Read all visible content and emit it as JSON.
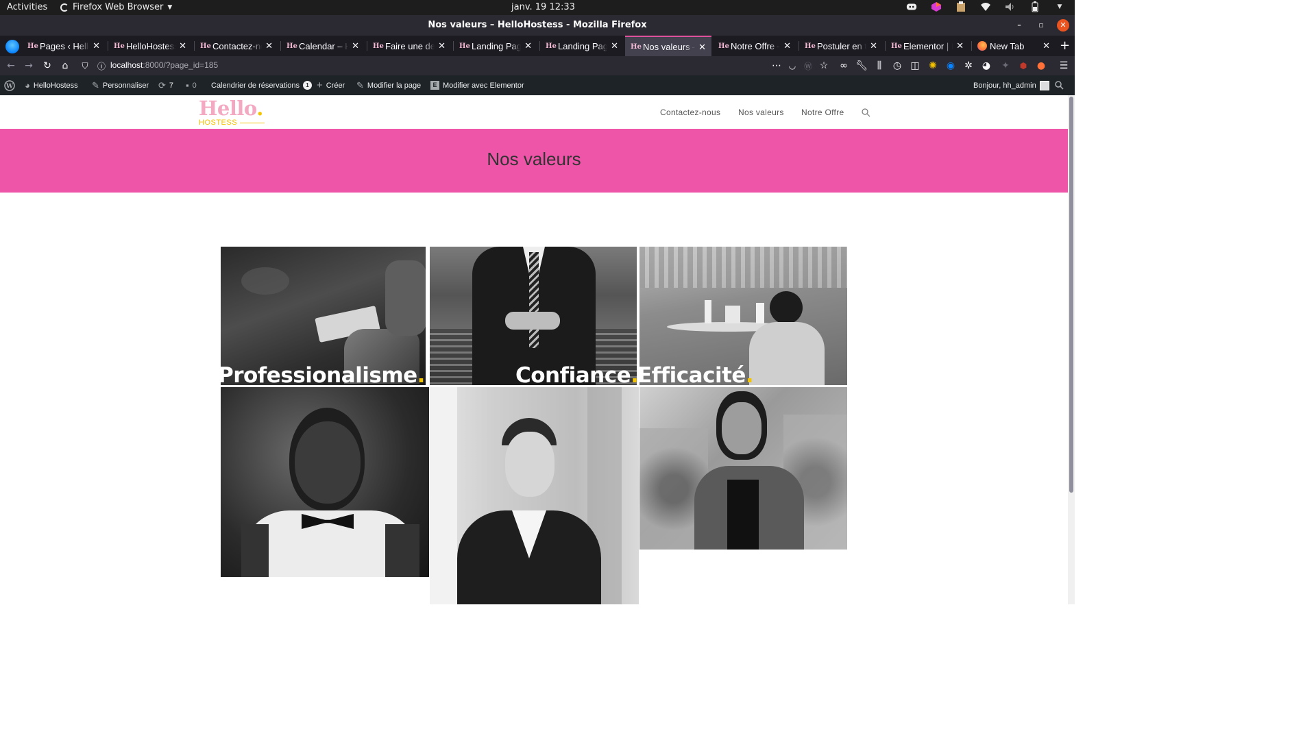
{
  "system": {
    "activities": "Activities",
    "app_menu": "Firefox Web Browser",
    "clock": "janv. 19  12:33"
  },
  "window": {
    "title": "Nos valeurs – HelloHostess - Mozilla Firefox"
  },
  "tabs": [
    {
      "favicon": "He",
      "label": "Pages ‹ HelloHostess"
    },
    {
      "favicon": "He",
      "label": "HelloHostess"
    },
    {
      "favicon": "He",
      "label": "Contactez-nous"
    },
    {
      "favicon": "He",
      "label": "Calendar – HelloHostess"
    },
    {
      "favicon": "He",
      "label": "Faire une demande"
    },
    {
      "favicon": "He",
      "label": "Landing Page"
    },
    {
      "favicon": "He",
      "label": "Landing Page"
    },
    {
      "favicon": "He",
      "label": "Nos valeurs –",
      "active": true
    },
    {
      "favicon": "He",
      "label": "Notre Offre –"
    },
    {
      "favicon": "He",
      "label": "Postuler en tant que"
    },
    {
      "favicon": "He",
      "label": "Elementor | Landing"
    },
    {
      "favicon": "firefox",
      "label": "New Tab"
    }
  ],
  "navbar": {
    "url_host": "localhost",
    "url_path": ":8000/?page_id=185"
  },
  "adminbar": {
    "site_name": "HelloHostess",
    "customize": "Personnaliser",
    "updates_count": "7",
    "comments_count": "0",
    "calendar": "Calendrier de réservations",
    "calendar_badge": "1",
    "new": "Créer",
    "edit_page": "Modifier la page",
    "edit_elementor": "Modifier avec Elementor",
    "greeting": "Bonjour, hh_admin"
  },
  "site": {
    "logo_text": "Hello",
    "logo_dot": ".",
    "logo_sub": "HOSTESS",
    "menu": [
      "Contactez-nous",
      "Nos valeurs",
      "Notre Offre"
    ],
    "page_title": "Nos valeurs"
  },
  "values": [
    {
      "title": "Professionalisme",
      "dot": "."
    },
    {
      "title": "Confiance",
      "dot": "."
    },
    {
      "title": "Efficacité",
      "dot": "."
    }
  ],
  "colors": {
    "banner": "#ee55a8",
    "logo_pink": "#f4a9c3",
    "accent_yellow": "#f5c400",
    "admin_bar": "#1d2327"
  }
}
